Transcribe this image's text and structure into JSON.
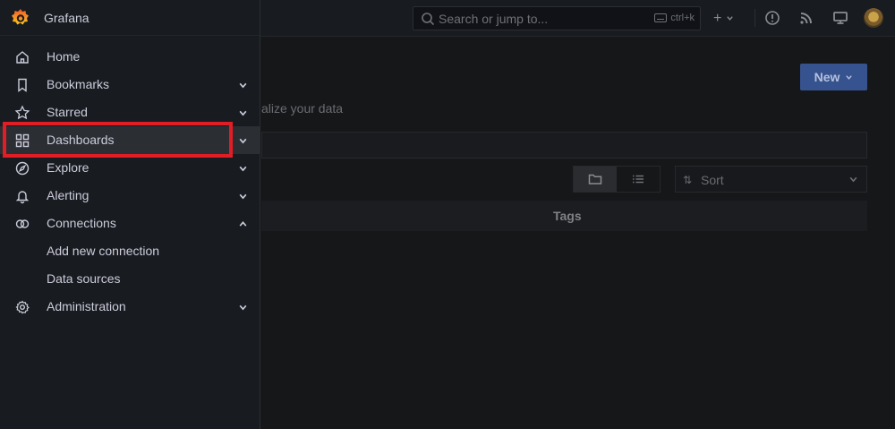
{
  "app": {
    "brand": "Grafana"
  },
  "topbar": {
    "search_placeholder": "Search or jump to...",
    "search_shortcut": "ctrl+k",
    "add_label": "+"
  },
  "page": {
    "new_button": "New",
    "subtitle_fragment": "alize your data",
    "sort_label": "Sort",
    "table_tags_header": "Tags"
  },
  "sidebar": {
    "items": [
      {
        "label": "Home",
        "icon": "home-icon",
        "chevron": ""
      },
      {
        "label": "Bookmarks",
        "icon": "bookmark-icon",
        "chevron": "down"
      },
      {
        "label": "Starred",
        "icon": "star-icon",
        "chevron": "down"
      },
      {
        "label": "Dashboards",
        "icon": "dashboards-grid-icon",
        "chevron": "down"
      },
      {
        "label": "Explore",
        "icon": "compass-icon",
        "chevron": "down"
      },
      {
        "label": "Alerting",
        "icon": "bell-icon",
        "chevron": "down"
      },
      {
        "label": "Connections",
        "icon": "connections-icon",
        "chevron": "up"
      },
      {
        "label": "Add new connection",
        "icon": "",
        "chevron": ""
      },
      {
        "label": "Data sources",
        "icon": "",
        "chevron": ""
      },
      {
        "label": "Administration",
        "icon": "gear-icon",
        "chevron": "down"
      }
    ]
  },
  "colors": {
    "highlight": "#e11d25",
    "brand_orange": "#f05a28",
    "primary_button": "#37538f"
  }
}
